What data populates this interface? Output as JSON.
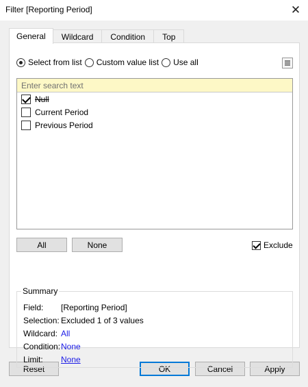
{
  "window": {
    "title": "Filter [Reporting Period]",
    "close_glyph": "✕"
  },
  "tabs": [
    {
      "label": "General",
      "active": true
    },
    {
      "label": "Wildcard",
      "active": false
    },
    {
      "label": "Condition",
      "active": false
    },
    {
      "label": "Top",
      "active": false
    }
  ],
  "mode": {
    "select_from_list": {
      "label": "Select from list",
      "checked": true
    },
    "custom_value_list": {
      "label": "Custom value list",
      "checked": false
    },
    "use_all": {
      "label": "Use all",
      "checked": false
    }
  },
  "search": {
    "placeholder": "Enter search text"
  },
  "values": [
    {
      "label": "Null",
      "checked": true,
      "struck": true
    },
    {
      "label": "Current Period",
      "checked": false,
      "struck": false
    },
    {
      "label": "Previous Period",
      "checked": false,
      "struck": false
    }
  ],
  "buttons": {
    "all": "All",
    "none": "None"
  },
  "exclude": {
    "label": "Exclude",
    "checked": true
  },
  "summary": {
    "legend": "Summary",
    "field_key": "Field:",
    "field_value": "[Reporting Period]",
    "selection_key": "Selection:",
    "selection_value": "Excluded 1 of 3 values",
    "wildcard_key": "Wildcard:",
    "wildcard_value": "All",
    "condition_key": "Condition:",
    "condition_value": "None",
    "limit_key": "Limit:",
    "limit_value": "None"
  },
  "footer": {
    "reset": "Reset",
    "ok": "OK",
    "cancel": "Cancel",
    "apply": "Apply"
  },
  "colors": {
    "link_blue": "#1a1ae6",
    "search_bg": "#fdf8c6",
    "focus_blue": "#0078d7"
  }
}
